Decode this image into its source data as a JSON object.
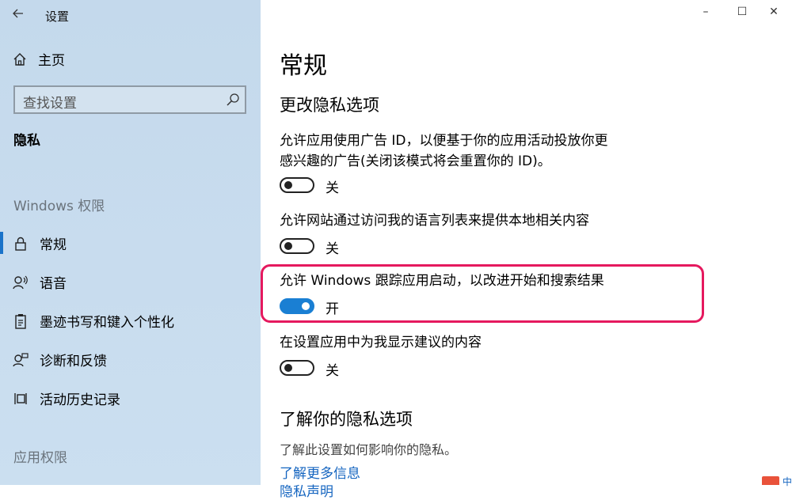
{
  "window": {
    "title": "设置",
    "controls": {
      "minimize": "–",
      "maximize": "☐",
      "close": "✕"
    }
  },
  "sidebar": {
    "home": "主页",
    "search_placeholder": "查找设置",
    "current_section": "隐私",
    "groups": [
      {
        "label": "Windows 权限",
        "items": [
          {
            "label": "常规",
            "icon": "lock-icon",
            "active": true
          },
          {
            "label": "语音",
            "icon": "speech-icon",
            "active": false
          },
          {
            "label": "墨迹书写和键入个性化",
            "icon": "clipboard-pen-icon",
            "active": false
          },
          {
            "label": "诊断和反馈",
            "icon": "feedback-person-icon",
            "active": false
          },
          {
            "label": "活动历史记录",
            "icon": "activity-history-icon",
            "active": false
          }
        ]
      },
      {
        "label": "应用权限",
        "items": []
      }
    ]
  },
  "main": {
    "title": "常规",
    "section_heading": "更改隐私选项",
    "options": [
      {
        "label_line1": "允许应用使用广告 ID，以便基于你的应用活动投放你更",
        "label_line2": "感兴趣的广告(关闭该模式将会重置你的 ID)。",
        "state": "关",
        "on": false
      },
      {
        "label_line1": "允许网站通过访问我的语言列表来提供本地相关内容",
        "state": "关",
        "on": false
      },
      {
        "label_line1": "允许 Windows 跟踪应用启动，以改进开始和搜索结果",
        "state": "开",
        "on": true
      },
      {
        "label_line1": "在设置应用中为我显示建议的内容",
        "state": "关",
        "on": false
      }
    ],
    "learn_heading": "了解你的隐私选项",
    "learn_desc": "了解此设置如何影响你的隐私。",
    "learn_link": "了解更多信息",
    "learn_link2": "隐私声明"
  },
  "tray": {
    "ime_char": "中"
  },
  "colors": {
    "sidebar_bg": "#c8dcee",
    "accent": "#1a7fd3",
    "highlight": "#e5195e",
    "link": "#1565c0"
  }
}
